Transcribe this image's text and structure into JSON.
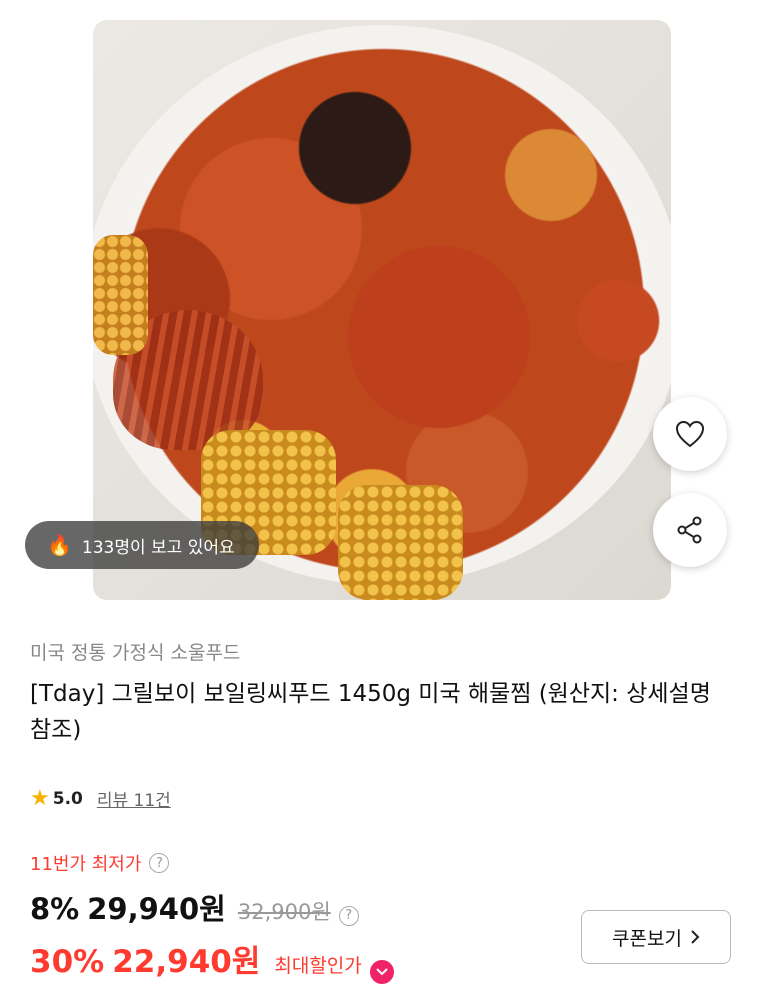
{
  "product_image": {
    "viewer_count_text": "133명이 보고 있어요",
    "viewer_icon": "fire-icon"
  },
  "actions": {
    "wishlist_icon": "heart-icon",
    "share_icon": "share-icon"
  },
  "seller": {
    "name": "미국 정통 가정식 소울푸드"
  },
  "product": {
    "title": "[Tday] 그릴보이 보일링씨푸드 1450g 미국 해물찜 (원산지: 상세설명 참조)"
  },
  "rating": {
    "score": "5.0",
    "review_label": "리뷰 11건",
    "star_color": "#f5b400"
  },
  "pricing": {
    "lowest_label": "11번가 최저가",
    "help_icon": "?",
    "discount_pct": "8%",
    "price": "29,940원",
    "original_price": "32,900원",
    "max_discount_pct": "30%",
    "max_price": "22,940원",
    "max_label": "최대할인가",
    "accent_color": "#ff3b2f"
  },
  "coupon": {
    "label": "쿠폰보기"
  }
}
